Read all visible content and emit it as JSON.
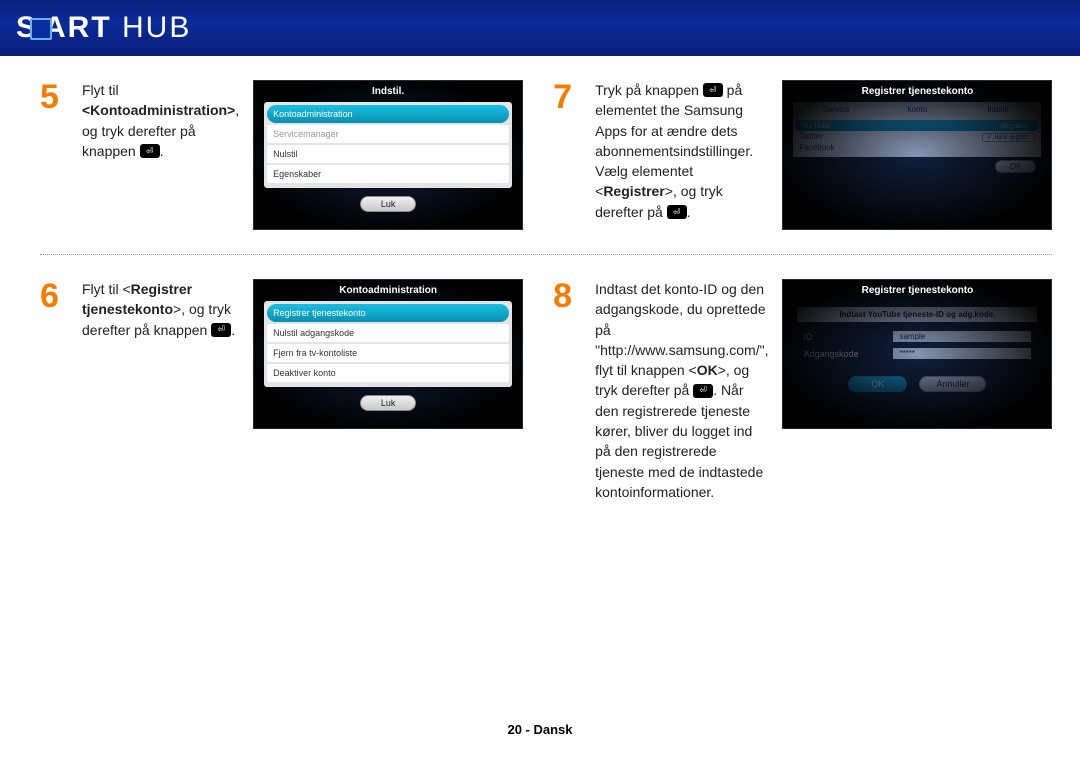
{
  "header": {
    "title_smart": "SM ART",
    "title_hub": " HUB"
  },
  "step5": {
    "num": "5",
    "text_parts": {
      "a": "Flyt til ",
      "b_bold": "<Kontoadministration>",
      "c": ", og tryk derefter på knappen ",
      "d": "."
    },
    "shot": {
      "title": "Indstil.",
      "items": [
        "Kontoadministration",
        "Servicemanager",
        "Nulstil",
        "Egenskaber"
      ],
      "luk": "Luk"
    }
  },
  "step6": {
    "num": "6",
    "text_parts": {
      "a": "Flyt til <",
      "b_bold": "Registrer tjenestekonto",
      "c": ">, og tryk derefter på knappen ",
      "d": "."
    },
    "shot": {
      "title": "Kontoadministration",
      "items": [
        "Registrer tjenestekonto",
        "Nulstil adgangskode",
        "Fjern fra tv-kontoliste",
        "Deaktiver konto"
      ],
      "luk": "Luk"
    }
  },
  "step7": {
    "num": "7",
    "text_parts": {
      "a": "Tryk på knappen ",
      "b": " på elementet the Samsung Apps for at ændre dets abonnementsindstillinger. Vælg elementet <",
      "c_bold": "Registrer",
      "d": ">, og tryk derefter på ",
      "e": "."
    },
    "shot": {
      "title": "Registrer tjenestekonto",
      "headers": [
        "Service",
        "konto",
        "Indstil."
      ],
      "rows": [
        {
          "svc": "YouTube",
          "konto": "",
          "ind": "Registrer",
          "sel": true
        },
        {
          "svc": "Twitter",
          "konto": "",
          "ind": "Ikke registr.",
          "sel": false
        },
        {
          "svc": "Facebook",
          "konto": "",
          "ind": "",
          "sel": false
        }
      ],
      "ok": "OK"
    }
  },
  "step8": {
    "num": "8",
    "text_parts": {
      "a": "Indtast det konto-ID og den adgangskode, du oprettede på \"http://www.samsung.com/\", flyt til knappen <",
      "b_bold": "OK",
      "c": ">, og tryk derefter på ",
      "d": ". Når den registrerede tjeneste kører, bliver du logget ind på den registrerede tjeneste med de indtastede kontoinformationer."
    },
    "shot": {
      "title": "Registrer tjenestekonto",
      "sub": "Indtast YouTube tjeneste-ID og adg.kode.",
      "id_label": "ID",
      "id_value": "sample",
      "pw_label": "Adgangskode",
      "pw_value": "*****",
      "ok": "OK",
      "annuller": "Annuller"
    }
  },
  "footer": "20 - Dansk"
}
